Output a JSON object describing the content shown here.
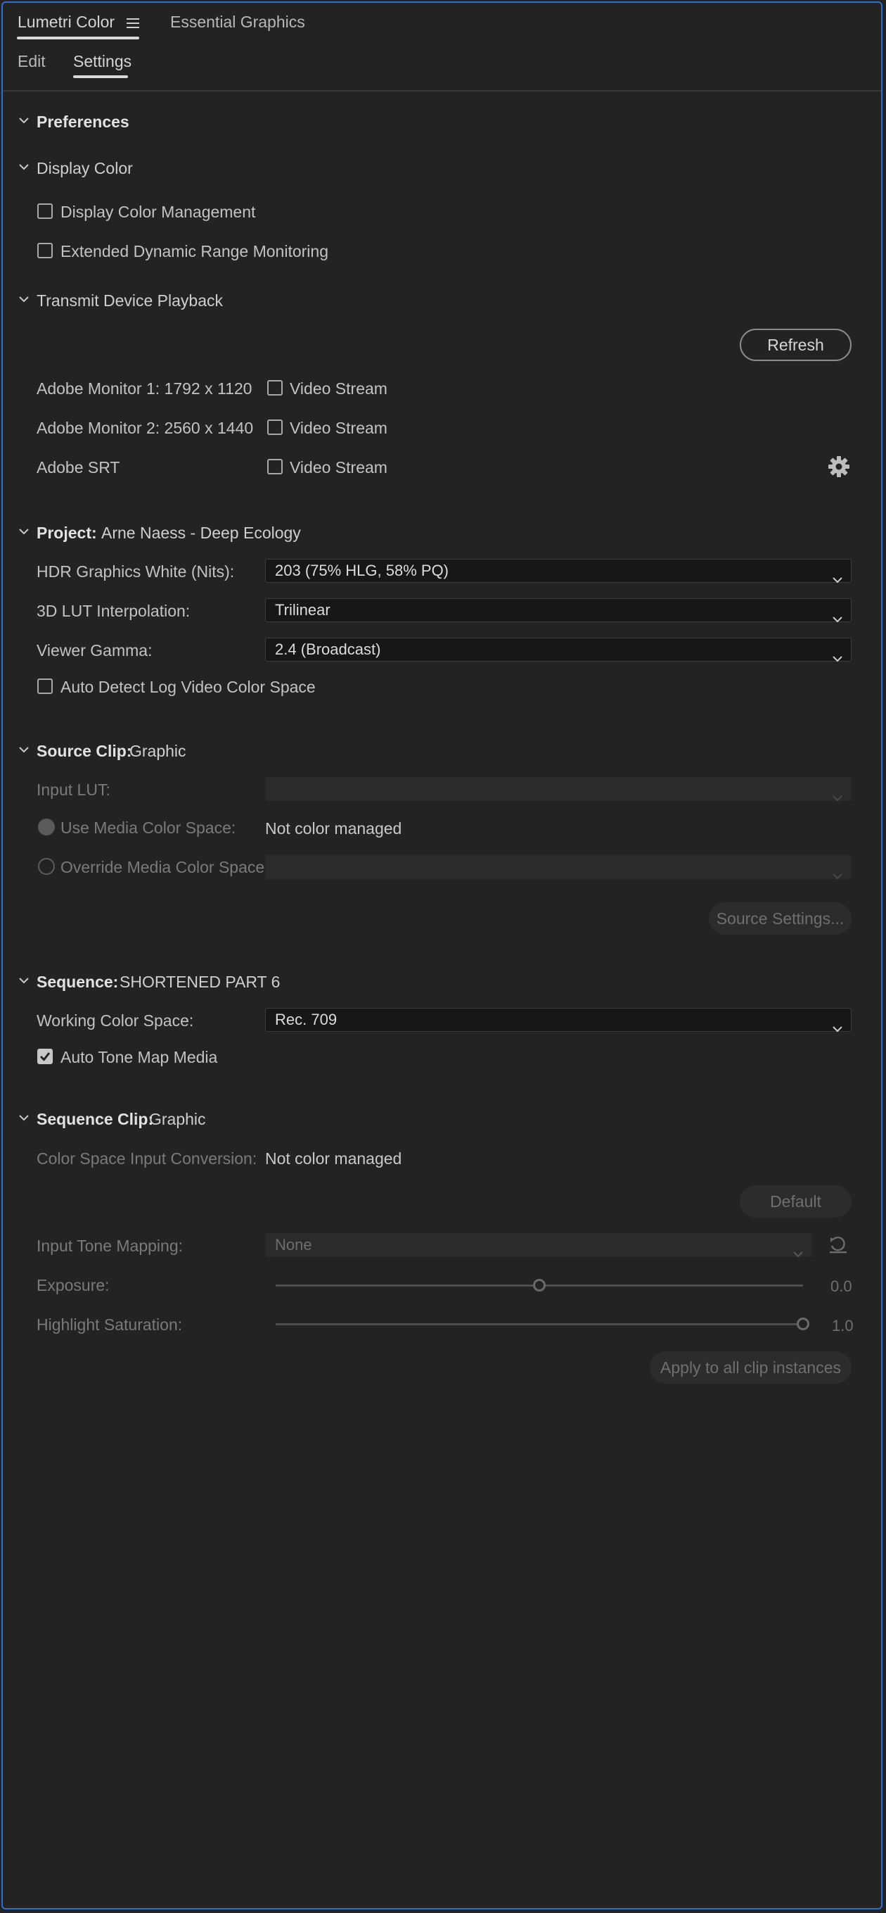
{
  "tabs": {
    "primary": [
      {
        "label": "Lumetri Color",
        "active": true
      },
      {
        "label": "Essential Graphics",
        "active": false
      }
    ],
    "secondary": [
      {
        "label": "Edit",
        "active": false
      },
      {
        "label": "Settings",
        "active": true
      }
    ]
  },
  "preferences": {
    "title": "Preferences"
  },
  "display_color": {
    "title": "Display Color",
    "options": [
      {
        "label": "Display Color Management",
        "checked": false
      },
      {
        "label": "Extended Dynamic Range Monitoring",
        "checked": false
      }
    ]
  },
  "transmit": {
    "title": "Transmit Device Playback",
    "refresh_label": "Refresh",
    "devices": [
      {
        "name": "Adobe Monitor 1: 1792 x 1120",
        "stream_label": "Video Stream",
        "checked": false
      },
      {
        "name": "Adobe Monitor 2: 2560 x 1440",
        "stream_label": "Video Stream",
        "checked": false
      },
      {
        "name": "Adobe SRT",
        "stream_label": "Video Stream",
        "checked": false
      }
    ]
  },
  "project": {
    "title": "Project:",
    "name": "Arne Naess - Deep Ecology",
    "hdr_label": "HDR Graphics White (Nits):",
    "hdr_value": "203 (75% HLG, 58% PQ)",
    "lut_label": "3D LUT Interpolation:",
    "lut_value": "Trilinear",
    "gamma_label": "Viewer Gamma:",
    "gamma_value": "2.4 (Broadcast)",
    "auto_detect_label": "Auto Detect Log Video Color Space",
    "auto_detect_checked": false
  },
  "source_clip": {
    "title": "Source Clip:",
    "name": "Graphic",
    "input_lut_label": "Input LUT:",
    "input_lut_value": "",
    "use_media_label": "Use Media Color Space:",
    "use_media_value": "Not color managed",
    "override_label": "Override Media Color Space:",
    "override_value": "",
    "settings_button": "Source Settings..."
  },
  "sequence": {
    "title": "Sequence:",
    "name": "SHORTENED PART 6",
    "working_label": "Working Color Space:",
    "working_value": "Rec. 709",
    "auto_tone_label": "Auto Tone Map Media",
    "auto_tone_checked": true
  },
  "sequence_clip": {
    "title": "Sequence Clip:",
    "name": "Graphic",
    "conversion_label": "Color Space Input Conversion:",
    "conversion_value": "Not color managed",
    "default_button": "Default",
    "tone_mapping_label": "Input Tone Mapping:",
    "tone_mapping_value": "None",
    "exposure_label": "Exposure:",
    "exposure_value": "0.0",
    "exposure_level": 0.5,
    "highlight_label": "Highlight Saturation:",
    "highlight_value": "1.0",
    "highlight_level": 1.0,
    "apply_button": "Apply to all clip instances"
  },
  "colors": {
    "background": "#232323",
    "border_accent": "#2d6fd1"
  },
  "icons": {
    "panel_menu": "hamburger-icon",
    "gear": "gear-icon",
    "reset": "reset-icon",
    "chevron": "chevron-down-icon"
  }
}
